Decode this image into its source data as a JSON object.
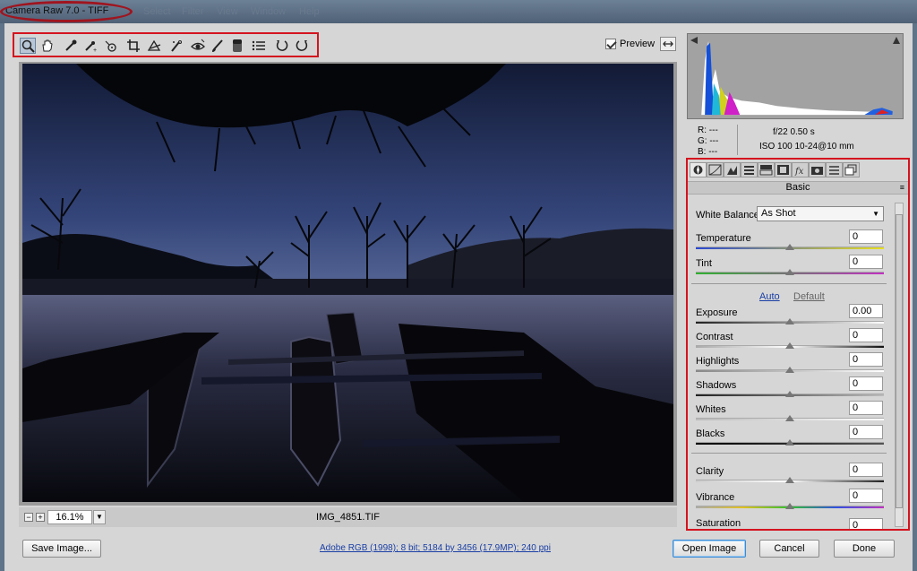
{
  "window": {
    "title": "Camera Raw 7.0  -  TIFF",
    "ghost_menu": [
      "Select",
      "Filter",
      "View",
      "Window",
      "Help"
    ]
  },
  "toolbar": {
    "tools": [
      "zoom-tool",
      "hand-tool",
      "white-balance-tool",
      "color-sampler-tool",
      "targeted-adjustment-tool",
      "crop-tool",
      "straighten-tool",
      "spot-removal-tool",
      "red-eye-removal-tool",
      "adjustment-brush",
      "graduated-filter",
      "open-preferences",
      "rotate-ccw",
      "rotate-cw"
    ],
    "preview_label": "Preview",
    "preview_checked": true
  },
  "preview": {
    "zoom_value": "16.1%",
    "filename": "IMG_4851.TIF"
  },
  "readout": {
    "r": "R:   ---",
    "g": "G:   ---",
    "b": "B:   ---",
    "aperture_shutter": "f/22   0.50 s",
    "iso_lens": "ISO 100   10-24@10 mm"
  },
  "panel": {
    "title": "Basic",
    "white_balance_label": "White Balance:",
    "white_balance_value": "As Shot",
    "temperature": {
      "label": "Temperature",
      "value": "0"
    },
    "tint": {
      "label": "Tint",
      "value": "0"
    },
    "auto_label": "Auto",
    "default_label": "Default",
    "exposure": {
      "label": "Exposure",
      "value": "0.00"
    },
    "contrast": {
      "label": "Contrast",
      "value": "0"
    },
    "highlights": {
      "label": "Highlights",
      "value": "0"
    },
    "shadows": {
      "label": "Shadows",
      "value": "0"
    },
    "whites": {
      "label": "Whites",
      "value": "0"
    },
    "blacks": {
      "label": "Blacks",
      "value": "0"
    },
    "clarity": {
      "label": "Clarity",
      "value": "0"
    },
    "vibrance": {
      "label": "Vibrance",
      "value": "0"
    },
    "saturation": {
      "label": "Saturation",
      "value": "0"
    }
  },
  "footer": {
    "save_label": "Save Image...",
    "info_link": "Adobe RGB (1998); 8 bit; 5184 by 3456 (17.9MP); 240 ppi",
    "open_label": "Open Image",
    "cancel_label": "Cancel",
    "done_label": "Done"
  },
  "colors": {
    "highlight_box": "#d4141f",
    "link": "#1a3fa5",
    "title_oval": "#a0141e"
  }
}
